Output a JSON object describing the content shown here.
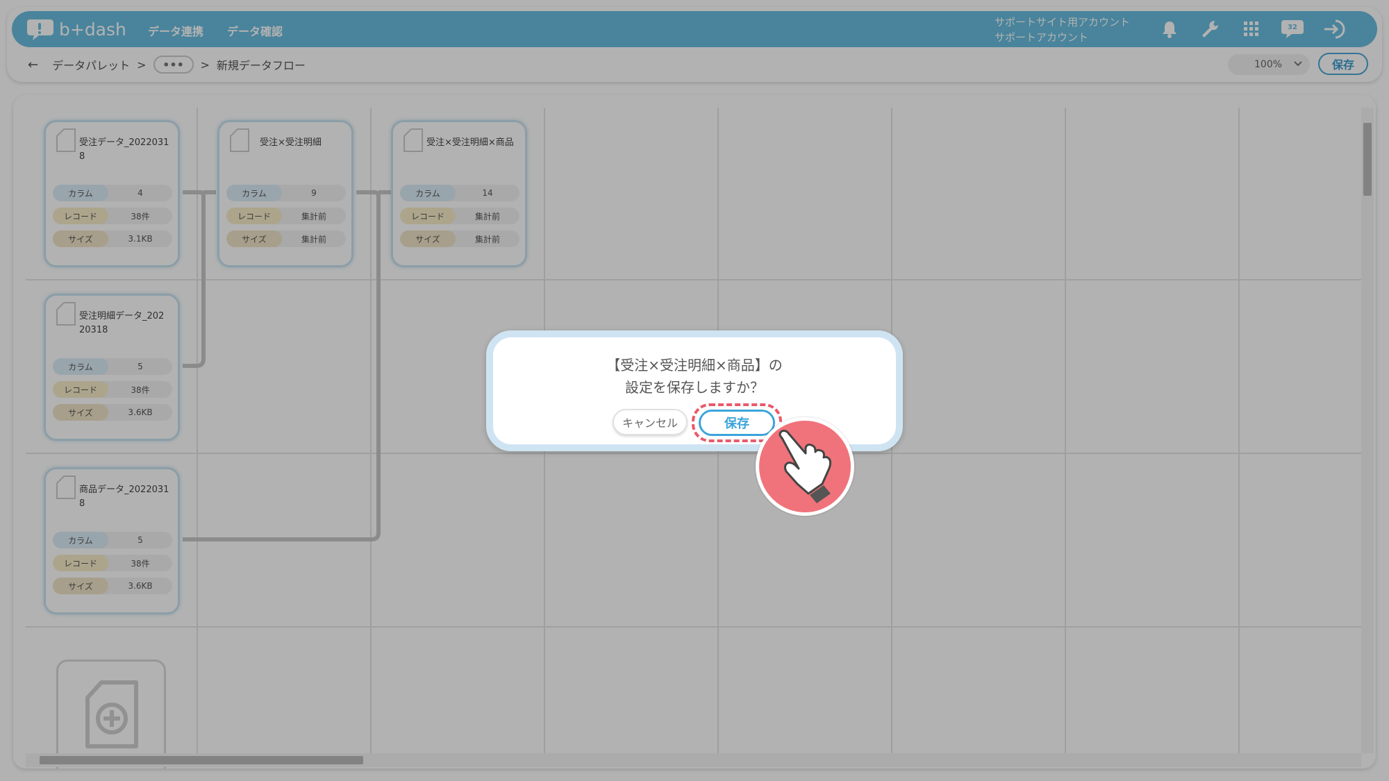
{
  "app": {
    "logo_text": "b+dash",
    "nav": [
      "データ連携",
      "データ確認"
    ],
    "account": {
      "line1": "サポートサイト用アカウント",
      "line2": "サポートアカウント"
    },
    "badge_count": "32",
    "accent_color": "#69bee0"
  },
  "breadcrumb": {
    "back_icon": "arrow-left-icon",
    "root": "データパレット",
    "sep1": ">",
    "ellipsis": "•••",
    "sep2": ">",
    "current": "新規データフロー"
  },
  "toolbar": {
    "zoom": "100%",
    "save_label": "保存"
  },
  "nodes": [
    {
      "name": "受注データ_20220318",
      "rows": [
        {
          "key": "カラム",
          "value": "4"
        },
        {
          "key": "レコード",
          "value": "38件"
        },
        {
          "key": "サイズ",
          "value": "3.1KB"
        }
      ]
    },
    {
      "name": "受注×受注明細",
      "rows": [
        {
          "key": "カラム",
          "value": "9"
        },
        {
          "key": "レコード",
          "value": "集計前"
        },
        {
          "key": "サイズ",
          "value": "集計前"
        }
      ]
    },
    {
      "name": "受注×受注明細×商品",
      "rows": [
        {
          "key": "カラム",
          "value": "14"
        },
        {
          "key": "レコード",
          "value": "集計前"
        },
        {
          "key": "サイズ",
          "value": "集計前"
        }
      ]
    },
    {
      "name": "受注明細データ_20220318",
      "rows": [
        {
          "key": "カラム",
          "value": "5"
        },
        {
          "key": "レコード",
          "value": "38件"
        },
        {
          "key": "サイズ",
          "value": "3.6KB"
        }
      ]
    },
    {
      "name": "商品データ_20220318",
      "rows": [
        {
          "key": "カラム",
          "value": "5"
        },
        {
          "key": "レコード",
          "value": "38件"
        },
        {
          "key": "サイズ",
          "value": "3.6KB"
        }
      ]
    }
  ],
  "dialog": {
    "line1": "【受注×受注明細×商品】の",
    "line2": "設定を保存しますか？",
    "cancel_label": "キャンセル",
    "save_label": "保存",
    "highlight_color": "#e85a6a"
  }
}
